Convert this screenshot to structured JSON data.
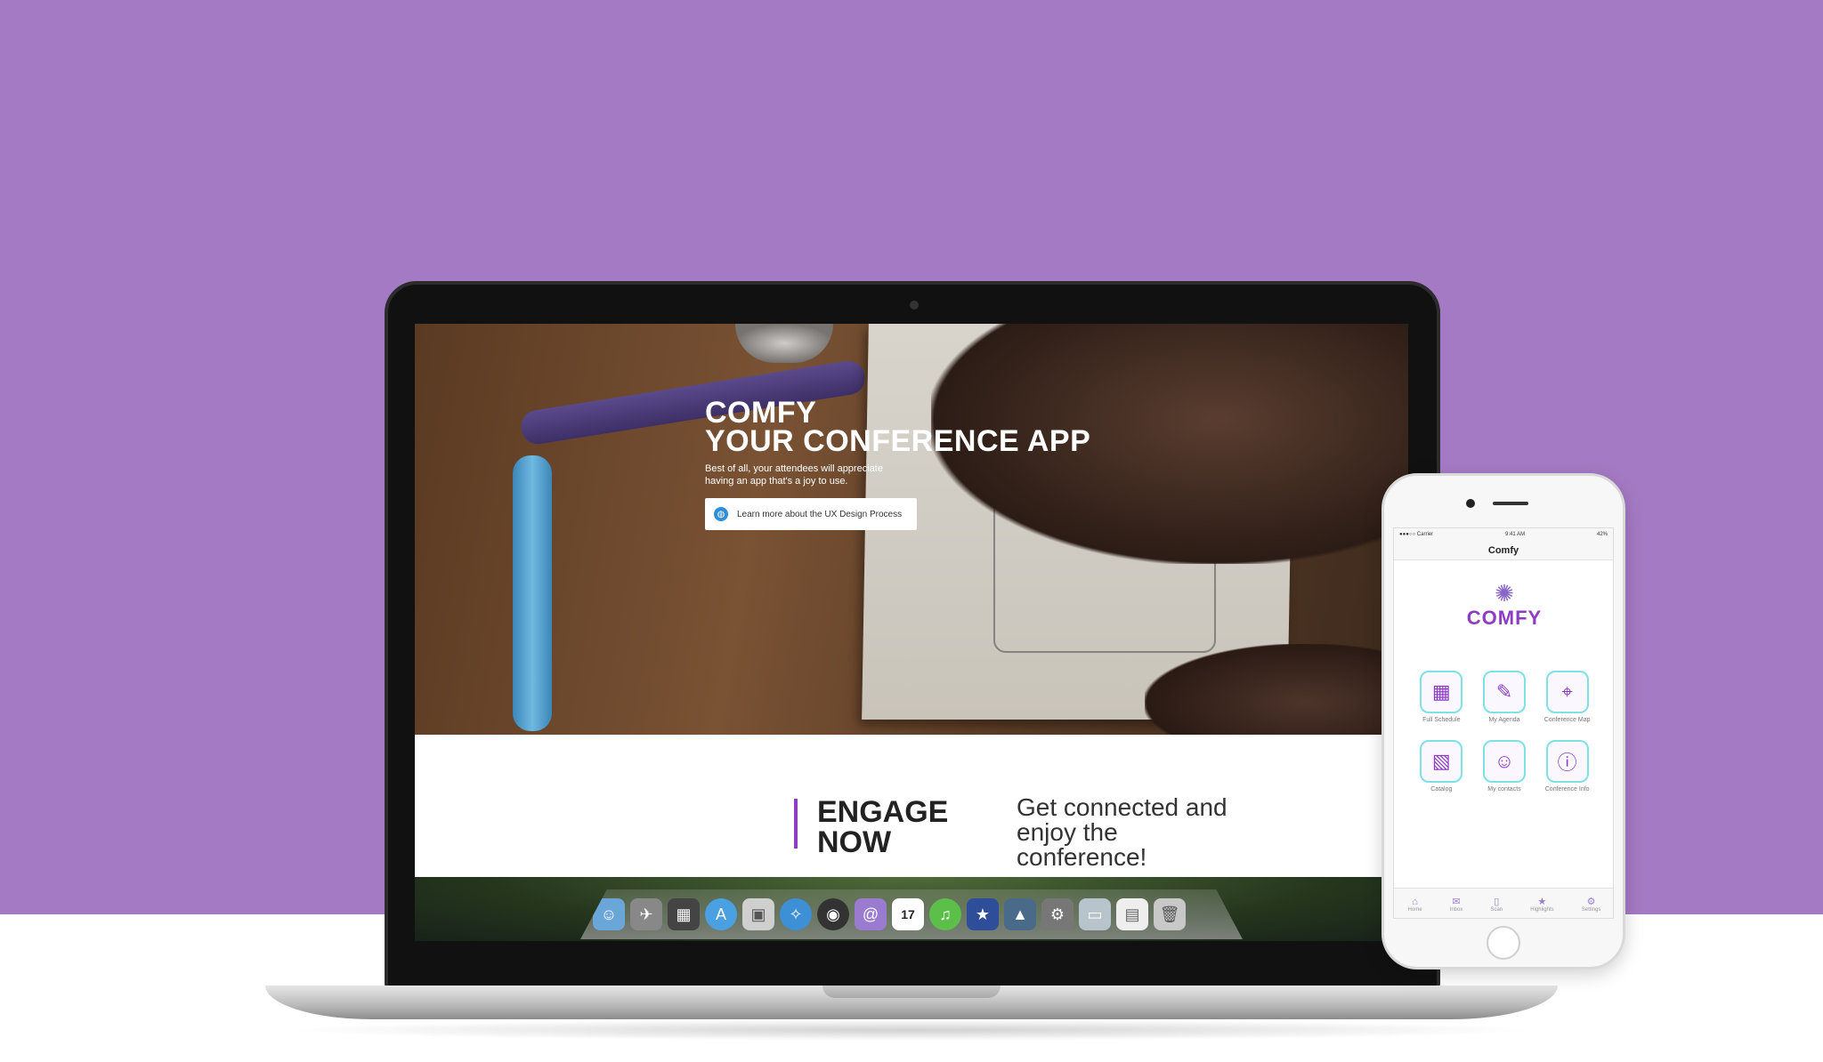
{
  "colors": {
    "background_band": "#a57ac4",
    "accent": "#8e3cc4",
    "tile_border": "#7fe0e6"
  },
  "hero": {
    "title_line1": "COMFY",
    "title_line2": "YOUR CONFERENCE APP",
    "subtitle": "Best of all, your attendees will appreciate having an app that's a joy to use.",
    "button_label": "Learn more about the UX Design Process",
    "button_icon": "globe-icon"
  },
  "engage": {
    "title_line1": "ENGAGE",
    "title_line2": "NOW",
    "text": "Get connected and enjoy the conference!"
  },
  "dock": {
    "icons": [
      "finder-icon",
      "launchpad-icon",
      "photo-icon",
      "app-store-icon",
      "preview-icon",
      "safari-icon",
      "dashboard-icon",
      "mail-icon",
      "calendar-icon",
      "itunes-icon",
      "imovie-icon",
      "iphoto-icon",
      "system-prefs-icon",
      "folder-icon",
      "document-icon",
      "trash-icon"
    ],
    "calendar_day": "17"
  },
  "phone": {
    "status": {
      "carrier": "●●●○○ Carrier",
      "time": "9:41 AM",
      "battery": "42%"
    },
    "nav_title": "Comfy",
    "logo_text": "COMFY",
    "tiles": [
      {
        "label": "Full Schedule",
        "icon": "calendar-icon"
      },
      {
        "label": "My Agenda",
        "icon": "checklist-icon"
      },
      {
        "label": "Conference Map",
        "icon": "map-pin-icon"
      },
      {
        "label": "Catalog",
        "icon": "catalog-icon"
      },
      {
        "label": "My contacts",
        "icon": "chat-icon"
      },
      {
        "label": "Conference Info",
        "icon": "info-icon"
      }
    ],
    "tabs": [
      {
        "label": "Home",
        "icon": "home-icon"
      },
      {
        "label": "Inbox",
        "icon": "inbox-icon"
      },
      {
        "label": "Scan",
        "icon": "scan-icon"
      },
      {
        "label": "Highlights",
        "icon": "star-icon"
      },
      {
        "label": "Settings",
        "icon": "gear-icon"
      }
    ]
  }
}
